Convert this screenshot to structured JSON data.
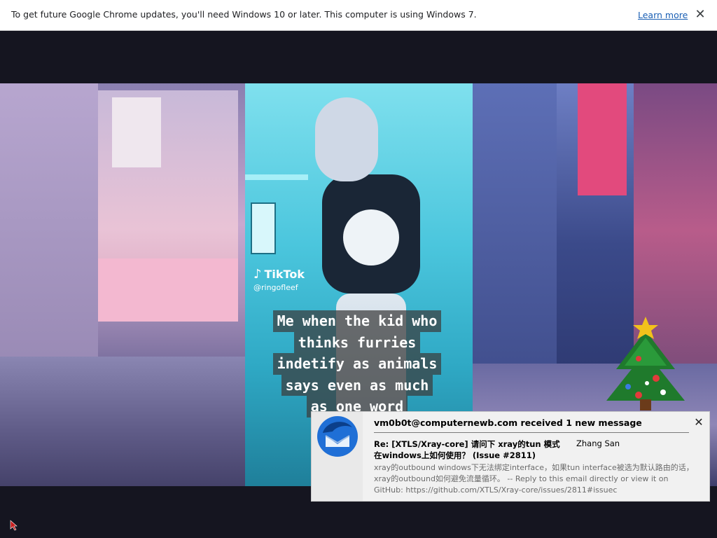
{
  "infobar": {
    "message": "To get future Google Chrome updates, you'll need Windows 10 or later. This computer is using Windows 7.",
    "learn_more": "Learn more",
    "close_glyph": "✕"
  },
  "video": {
    "tiktok_logo": "TikTok",
    "tiktok_glyph": "♪",
    "handle": "@ringofleef",
    "caption_lines": [
      "Me when the kid who",
      "thinks furries",
      "indetify as animals",
      "says even as much",
      "as one word"
    ]
  },
  "notification": {
    "title": "vm0b0t@computernewb.com received 1 new message",
    "subject": "Re: [XTLS/Xray-core] 请问下 xray的tun 模式在windows上如何使用？ (Issue #2811)",
    "sender": "Zhang San",
    "body": "xray的outbound windows下无法绑定interface，如果tun interface被选为默认路由的话，xray的outbound如何避免流量循环。 -- Reply to this email directly or view it on GitHub: https://github.com/XTLS/Xray-core/issues/2811#issuec",
    "close_glyph": "✕",
    "icon": "thunderbird-icon"
  },
  "colors": {
    "infobar_bg": "#ffffff",
    "link": "#1a5fb4",
    "player_bg": "#151520",
    "notification_bg": "#f1f1f1"
  }
}
